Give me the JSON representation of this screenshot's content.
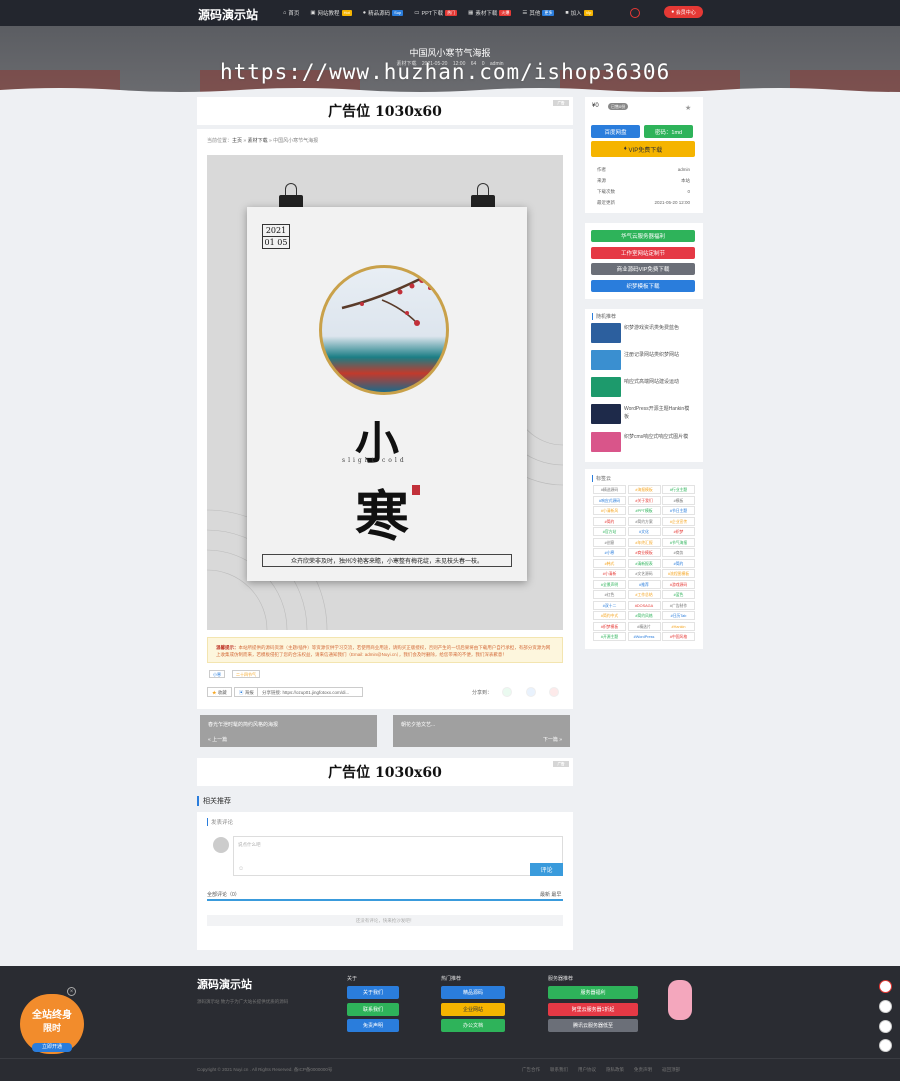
{
  "site": {
    "logo": "源码演示站",
    "member_label": "会员中心"
  },
  "nav": [
    {
      "label": "首页",
      "badge": ""
    },
    {
      "label": "网站教程",
      "badge": "Hot"
    },
    {
      "label": "精品源码",
      "badge": "Sup"
    },
    {
      "label": "PPT下载",
      "badge": "热门"
    },
    {
      "label": "素材下载",
      "badge": "火爆"
    },
    {
      "label": "其他",
      "badge": "更多"
    },
    {
      "label": "加入",
      "badge": "Vip"
    }
  ],
  "hero": {
    "title": "中国风小寒节气海报",
    "meta": "素材下载  2021-05-20 12:00  64  0  admin",
    "watermark": "https://www.huzhan.com/ishop36306"
  },
  "ad": {
    "text": "广告位 1030x60",
    "tag": "广告"
  },
  "breadcrumb": {
    "prefix": "当前位置：",
    "home": "主页",
    "sep": "»",
    "cat": "素材下载",
    "current": "中国风小寒节气海报"
  },
  "poster": {
    "year": "2021",
    "date": "01 05",
    "chars": [
      "小",
      "寒"
    ],
    "sub": "slight cold",
    "bottom": "众卉欣荣非及时，独州冷艳客来瞻，小寒整有梅花绽，未见枝头春一枝。",
    "mark": "千图网"
  },
  "notice": {
    "label": "温馨提示：",
    "text": "本站所提供的源码资源（主题/插件）等资源仅供学习交流，若使用商业用途，请购买正版授权，否则产生的一切后果将由下载用户自行承担，有部分资源为网上收集或仿制而来，若模板侵犯了您的合法权益，请来信通知我们（Email: admin@Nuyi.cn），我们会及时删除，给您带来的不便，我们深表歉意！"
  },
  "tags": [
    "小寒",
    "二十四节气"
  ],
  "actions": {
    "collect": "收藏",
    "share": "海报",
    "link": "分享链接: https://ozup01.jingfotoxx.com/di...",
    "share_to": "分享到："
  },
  "prevnext": {
    "prev_title": "春光乍泄时髦的简约风格的海报",
    "prev": "« 上一篇",
    "next_title": "朝花夕拾文艺...",
    "next": "下一篇 »"
  },
  "related": {
    "title": "相关推荐"
  },
  "comment": {
    "title": "发表评论",
    "placeholder": "说点什么吧",
    "submit": "评论",
    "count": "全部评论（0）",
    "sort": "最新  最早",
    "empty": "还没有评论，快来抢沙发吧！"
  },
  "sidebar": {
    "price": "¥0",
    "price_badge": "已售0份",
    "btn_baidu": "百度网盘",
    "btn_code": "密码：1md",
    "btn_vip": "VIP免费下载",
    "info": [
      {
        "k": "作者",
        "v": "admin"
      },
      {
        "k": "来源",
        "v": "本站"
      },
      {
        "k": "下载次数",
        "v": "0"
      },
      {
        "k": "最近更新",
        "v": "2021-05-20 12:00"
      }
    ],
    "promo": [
      "华气云服务器福利",
      "工作室网站定制节",
      "商业源码VIP免费下载",
      "织梦模板下载"
    ],
    "rand_title": "随机推荐",
    "rand": [
      "织梦游戏资讯类免费蓝色",
      "注册记录网站类织梦网站",
      "响应式高端网站建设运动",
      "WordPress开源主题Hankin模板",
      "织梦cms响应式响应式图片模"
    ],
    "tag_title": "标签云",
    "tagcloud": [
      "#精选源码",
      "#海报模板",
      "#行业主题",
      "#响应式源码",
      "#关于我们",
      "#模板",
      "#小清新风",
      "#PPT模板",
      "#节日主题",
      "#简约",
      "#简约方案",
      "#企业宣传",
      "#官方站",
      "#文化",
      "#织梦",
      "#创意",
      "#年终汇报",
      "#节气海报",
      "#小寒",
      "#商业模板",
      "#商务",
      "#韩式",
      "#清新报表",
      "#简约",
      "#小清新",
      "#文艺源码",
      "#流程图模板",
      "#全景声明",
      "#推荐",
      "#游戏源码",
      "#红色",
      "#工作总结",
      "#蓝色",
      "#双十二",
      "#DOSAGA",
      "#广告制作",
      "#简约中式",
      "#简约风格",
      "#日历Tab",
      "#织梦模板",
      "#精选片",
      "#Hankin",
      "#开源主题",
      "#WordPress",
      "#中国风格"
    ]
  },
  "footer": {
    "logo": "源码演示站",
    "desc": "源码演示站 致力于为广大站长提供优质的源码",
    "col1_title": "关于",
    "col1": [
      "关于我们",
      "联系我们",
      "免责声明"
    ],
    "col2_title": "热门推荐",
    "col2": [
      "精品源码",
      "企业网站",
      "办公文档"
    ],
    "col3_title": "服务器推荐",
    "col3": [
      "服务器福利",
      "阿里云服务器1折起",
      "腾讯云服务器低至"
    ],
    "copyright": "Copyright © 2021 Nuyi.cn . All Rights Reserved. 备ICP备0000000号",
    "links": [
      "广告合作",
      "联系我们",
      "用户协议",
      "隐私政策",
      "免责声明",
      "返回顶部"
    ],
    "promo_line1": "全站终身",
    "promo_line2": "限时",
    "promo_btn": "立即开通"
  }
}
